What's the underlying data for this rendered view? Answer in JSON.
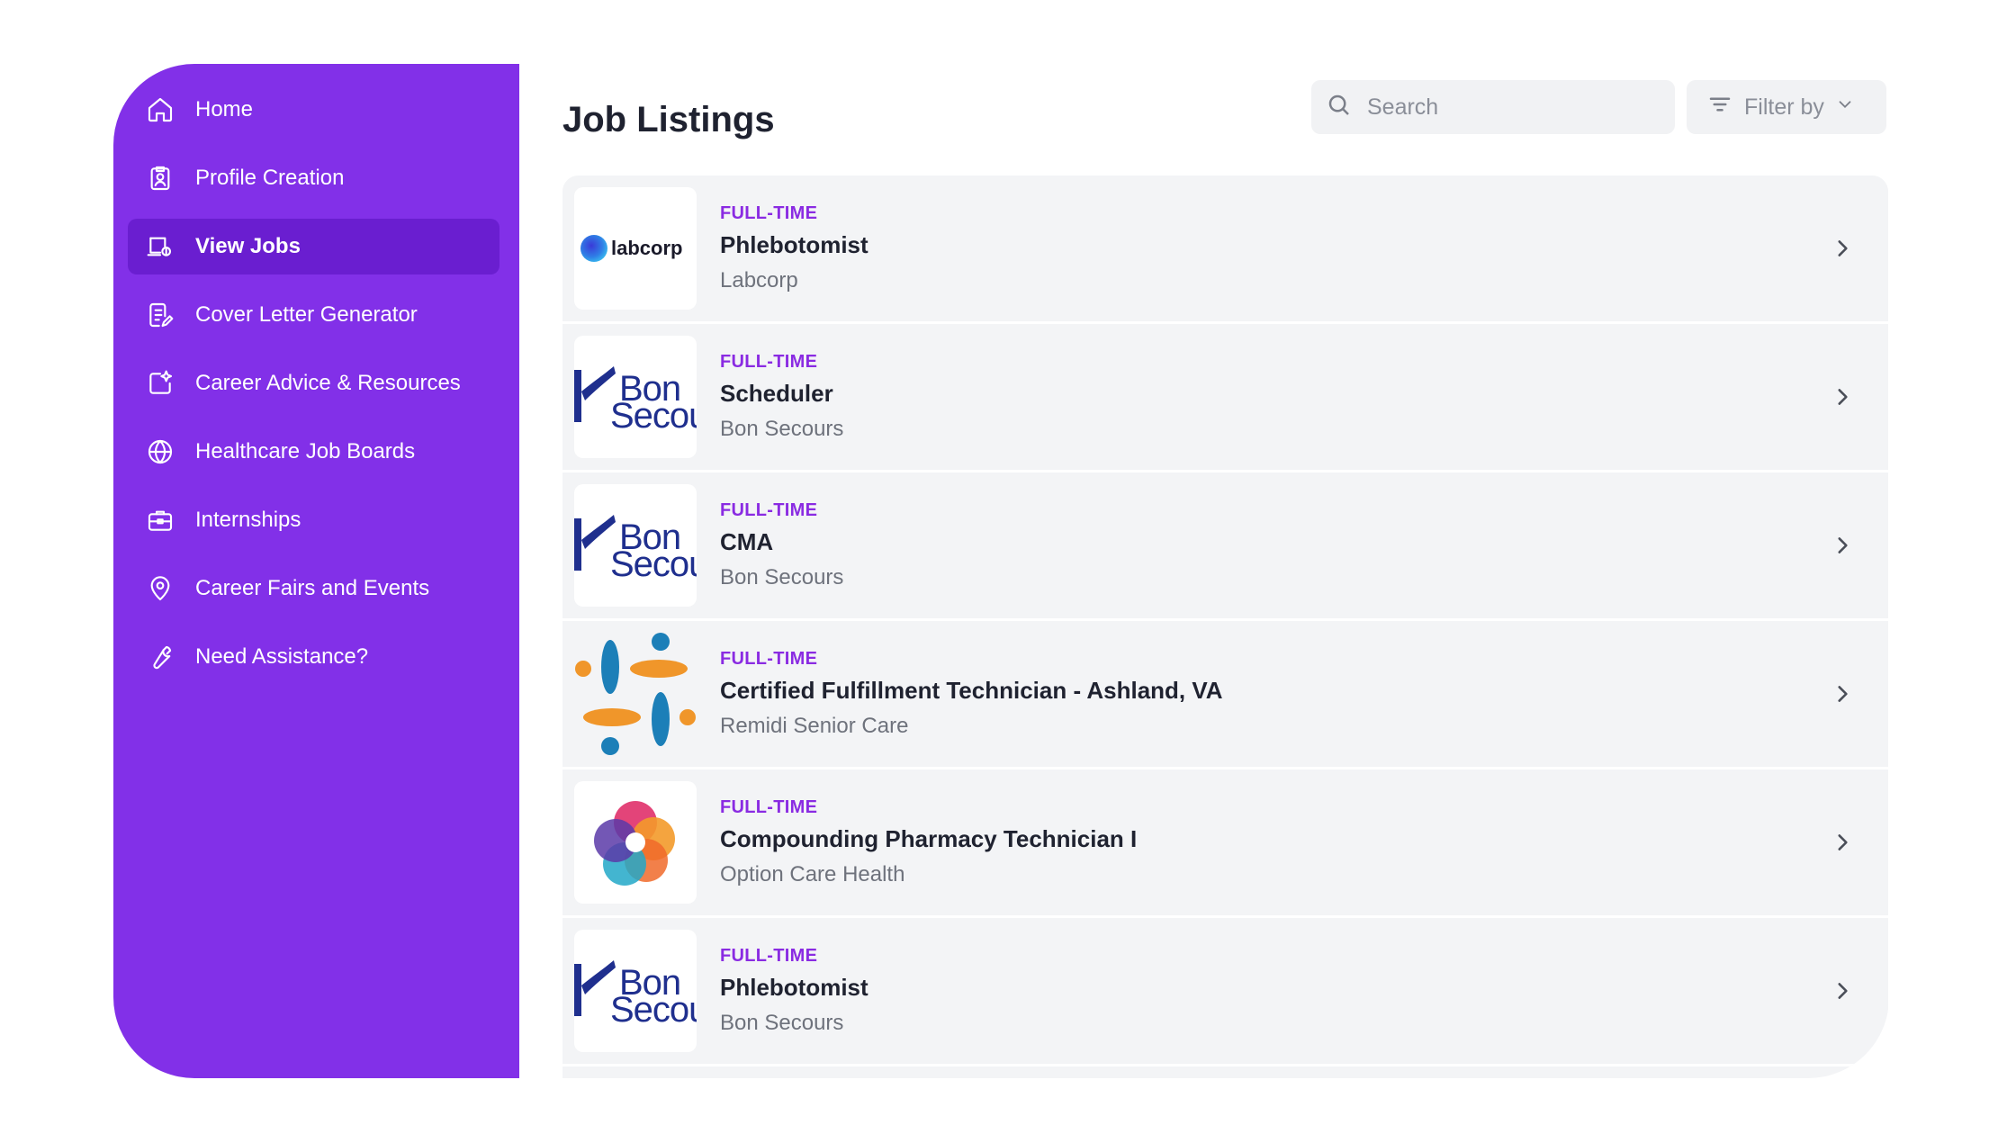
{
  "sidebar": {
    "items": [
      {
        "label": "Home",
        "icon": "home-icon",
        "active": false
      },
      {
        "label": "Profile Creation",
        "icon": "profile-badge-icon",
        "active": false
      },
      {
        "label": "View Jobs",
        "icon": "job-search-icon",
        "active": true
      },
      {
        "label": "Cover Letter Generator",
        "icon": "document-edit-icon",
        "active": false
      },
      {
        "label": "Career Advice & Resources",
        "icon": "sparkle-share-icon",
        "active": false
      },
      {
        "label": "Healthcare Job Boards",
        "icon": "globe-icon",
        "active": false
      },
      {
        "label": "Internships",
        "icon": "briefcase-icon",
        "active": false
      },
      {
        "label": "Career Fairs and Events",
        "icon": "location-pin-icon",
        "active": false
      },
      {
        "label": "Need Assistance?",
        "icon": "wrench-icon",
        "active": false
      }
    ]
  },
  "header": {
    "title": "Job Listings",
    "search_placeholder": "Search",
    "filter_label": "Filter by"
  },
  "jobs": [
    {
      "type": "FULL-TIME",
      "title": "Phlebotomist",
      "company": "Labcorp",
      "logo_text": "labcorp"
    },
    {
      "type": "FULL-TIME",
      "title": "Scheduler",
      "company": "Bon Secours",
      "logo_text": "Bon Secou"
    },
    {
      "type": "FULL-TIME",
      "title": "CMA",
      "company": "Bon Secours",
      "logo_text": "Bon Secou"
    },
    {
      "type": "FULL-TIME",
      "title": "Certified Fulfillment Technician - Ashland, VA",
      "company": "Remidi Senior Care"
    },
    {
      "type": "FULL-TIME",
      "title": "Compounding Pharmacy Technician I",
      "company": "Option Care Health"
    },
    {
      "type": "FULL-TIME",
      "title": "Phlebotomist",
      "company": "Bon Secours",
      "logo_text": "Bon Secou"
    }
  ],
  "colors": {
    "sidebar_bg": "#8230e8",
    "sidebar_active": "#6a1ed0",
    "accent_text": "#8a2be2",
    "row_bg": "#f3f4f6"
  }
}
